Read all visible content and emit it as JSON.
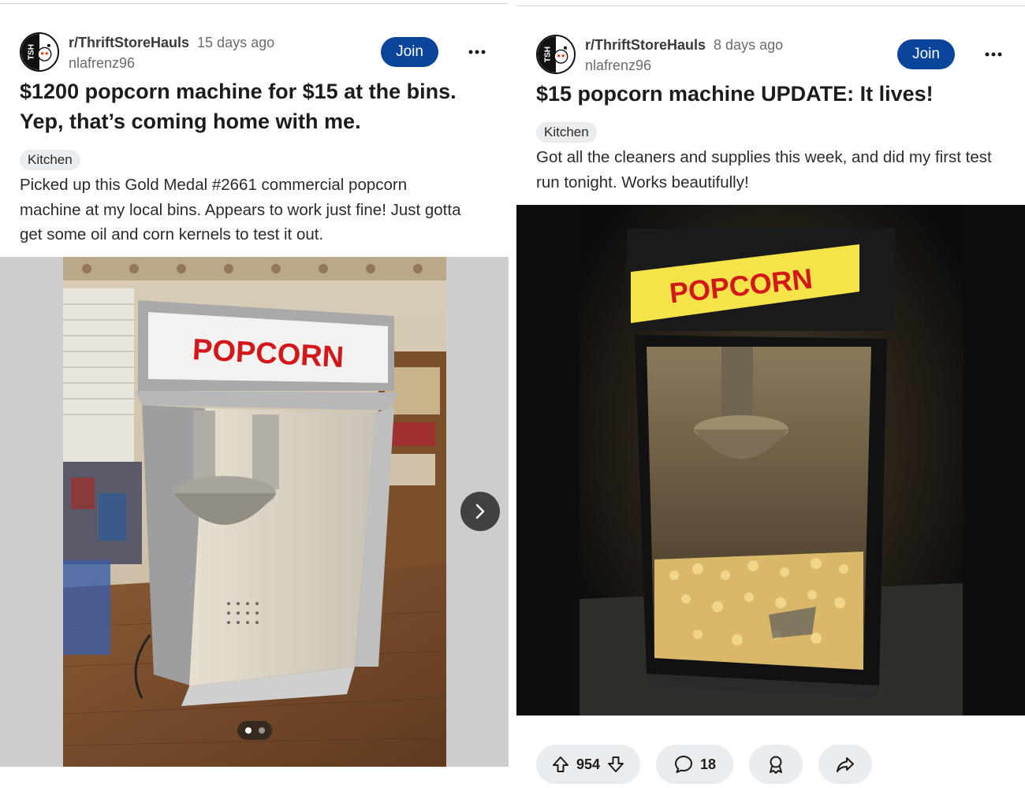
{
  "posts": [
    {
      "subreddit": "r/ThriftStoreHauls",
      "time": "15 days ago",
      "user": "nlafrenz96",
      "join_label": "Join",
      "title": "$1200 popcorn machine for $15 at the bins. Yep, that’s coming home with me.",
      "flair": "Kitchen",
      "body": "Picked up this Gold Medal #2661 commercial popcorn machine at my local bins. Appears to work just fine! Just gotta get some oil and corn kernels to test it out.",
      "gallery": {
        "count": 2,
        "active_index": 0
      },
      "image_sign": "POPCORN"
    },
    {
      "subreddit": "r/ThriftStoreHauls",
      "time": "8 days ago",
      "user": "nlafrenz96",
      "join_label": "Join",
      "title": "$15 popcorn machine UPDATE: It lives!",
      "flair": "Kitchen",
      "body": "Got all the cleaners and supplies this week, and did my first test run tonight. Works beautifully!",
      "image_sign": "POPCORN",
      "actions": {
        "votes": "954",
        "comments": "18"
      }
    }
  ],
  "avatar_text": "TSH",
  "colors": {
    "join": "#0a449b",
    "pill": "#eaedef",
    "sign_red": "#d3171b",
    "sign_yellow": "#f4e44a"
  },
  "icons": [
    "more-icon",
    "chevron-right-icon",
    "upvote-icon",
    "downvote-icon",
    "comment-icon",
    "award-icon",
    "share-icon"
  ]
}
